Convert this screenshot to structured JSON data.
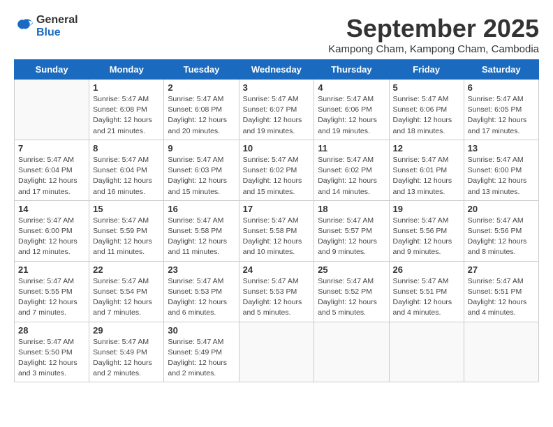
{
  "logo": {
    "general": "General",
    "blue": "Blue"
  },
  "title": "September 2025",
  "subtitle": "Kampong Cham, Kampong Cham, Cambodia",
  "headers": [
    "Sunday",
    "Monday",
    "Tuesday",
    "Wednesday",
    "Thursday",
    "Friday",
    "Saturday"
  ],
  "weeks": [
    [
      {
        "day": "",
        "text": ""
      },
      {
        "day": "1",
        "text": "Sunrise: 5:47 AM\nSunset: 6:08 PM\nDaylight: 12 hours\nand 21 minutes."
      },
      {
        "day": "2",
        "text": "Sunrise: 5:47 AM\nSunset: 6:08 PM\nDaylight: 12 hours\nand 20 minutes."
      },
      {
        "day": "3",
        "text": "Sunrise: 5:47 AM\nSunset: 6:07 PM\nDaylight: 12 hours\nand 19 minutes."
      },
      {
        "day": "4",
        "text": "Sunrise: 5:47 AM\nSunset: 6:06 PM\nDaylight: 12 hours\nand 19 minutes."
      },
      {
        "day": "5",
        "text": "Sunrise: 5:47 AM\nSunset: 6:06 PM\nDaylight: 12 hours\nand 18 minutes."
      },
      {
        "day": "6",
        "text": "Sunrise: 5:47 AM\nSunset: 6:05 PM\nDaylight: 12 hours\nand 17 minutes."
      }
    ],
    [
      {
        "day": "7",
        "text": "Sunrise: 5:47 AM\nSunset: 6:04 PM\nDaylight: 12 hours\nand 17 minutes."
      },
      {
        "day": "8",
        "text": "Sunrise: 5:47 AM\nSunset: 6:04 PM\nDaylight: 12 hours\nand 16 minutes."
      },
      {
        "day": "9",
        "text": "Sunrise: 5:47 AM\nSunset: 6:03 PM\nDaylight: 12 hours\nand 15 minutes."
      },
      {
        "day": "10",
        "text": "Sunrise: 5:47 AM\nSunset: 6:02 PM\nDaylight: 12 hours\nand 15 minutes."
      },
      {
        "day": "11",
        "text": "Sunrise: 5:47 AM\nSunset: 6:02 PM\nDaylight: 12 hours\nand 14 minutes."
      },
      {
        "day": "12",
        "text": "Sunrise: 5:47 AM\nSunset: 6:01 PM\nDaylight: 12 hours\nand 13 minutes."
      },
      {
        "day": "13",
        "text": "Sunrise: 5:47 AM\nSunset: 6:00 PM\nDaylight: 12 hours\nand 13 minutes."
      }
    ],
    [
      {
        "day": "14",
        "text": "Sunrise: 5:47 AM\nSunset: 6:00 PM\nDaylight: 12 hours\nand 12 minutes."
      },
      {
        "day": "15",
        "text": "Sunrise: 5:47 AM\nSunset: 5:59 PM\nDaylight: 12 hours\nand 11 minutes."
      },
      {
        "day": "16",
        "text": "Sunrise: 5:47 AM\nSunset: 5:58 PM\nDaylight: 12 hours\nand 11 minutes."
      },
      {
        "day": "17",
        "text": "Sunrise: 5:47 AM\nSunset: 5:58 PM\nDaylight: 12 hours\nand 10 minutes."
      },
      {
        "day": "18",
        "text": "Sunrise: 5:47 AM\nSunset: 5:57 PM\nDaylight: 12 hours\nand 9 minutes."
      },
      {
        "day": "19",
        "text": "Sunrise: 5:47 AM\nSunset: 5:56 PM\nDaylight: 12 hours\nand 9 minutes."
      },
      {
        "day": "20",
        "text": "Sunrise: 5:47 AM\nSunset: 5:56 PM\nDaylight: 12 hours\nand 8 minutes."
      }
    ],
    [
      {
        "day": "21",
        "text": "Sunrise: 5:47 AM\nSunset: 5:55 PM\nDaylight: 12 hours\nand 7 minutes."
      },
      {
        "day": "22",
        "text": "Sunrise: 5:47 AM\nSunset: 5:54 PM\nDaylight: 12 hours\nand 7 minutes."
      },
      {
        "day": "23",
        "text": "Sunrise: 5:47 AM\nSunset: 5:53 PM\nDaylight: 12 hours\nand 6 minutes."
      },
      {
        "day": "24",
        "text": "Sunrise: 5:47 AM\nSunset: 5:53 PM\nDaylight: 12 hours\nand 5 minutes."
      },
      {
        "day": "25",
        "text": "Sunrise: 5:47 AM\nSunset: 5:52 PM\nDaylight: 12 hours\nand 5 minutes."
      },
      {
        "day": "26",
        "text": "Sunrise: 5:47 AM\nSunset: 5:51 PM\nDaylight: 12 hours\nand 4 minutes."
      },
      {
        "day": "27",
        "text": "Sunrise: 5:47 AM\nSunset: 5:51 PM\nDaylight: 12 hours\nand 4 minutes."
      }
    ],
    [
      {
        "day": "28",
        "text": "Sunrise: 5:47 AM\nSunset: 5:50 PM\nDaylight: 12 hours\nand 3 minutes."
      },
      {
        "day": "29",
        "text": "Sunrise: 5:47 AM\nSunset: 5:49 PM\nDaylight: 12 hours\nand 2 minutes."
      },
      {
        "day": "30",
        "text": "Sunrise: 5:47 AM\nSunset: 5:49 PM\nDaylight: 12 hours\nand 2 minutes."
      },
      {
        "day": "",
        "text": ""
      },
      {
        "day": "",
        "text": ""
      },
      {
        "day": "",
        "text": ""
      },
      {
        "day": "",
        "text": ""
      }
    ]
  ]
}
